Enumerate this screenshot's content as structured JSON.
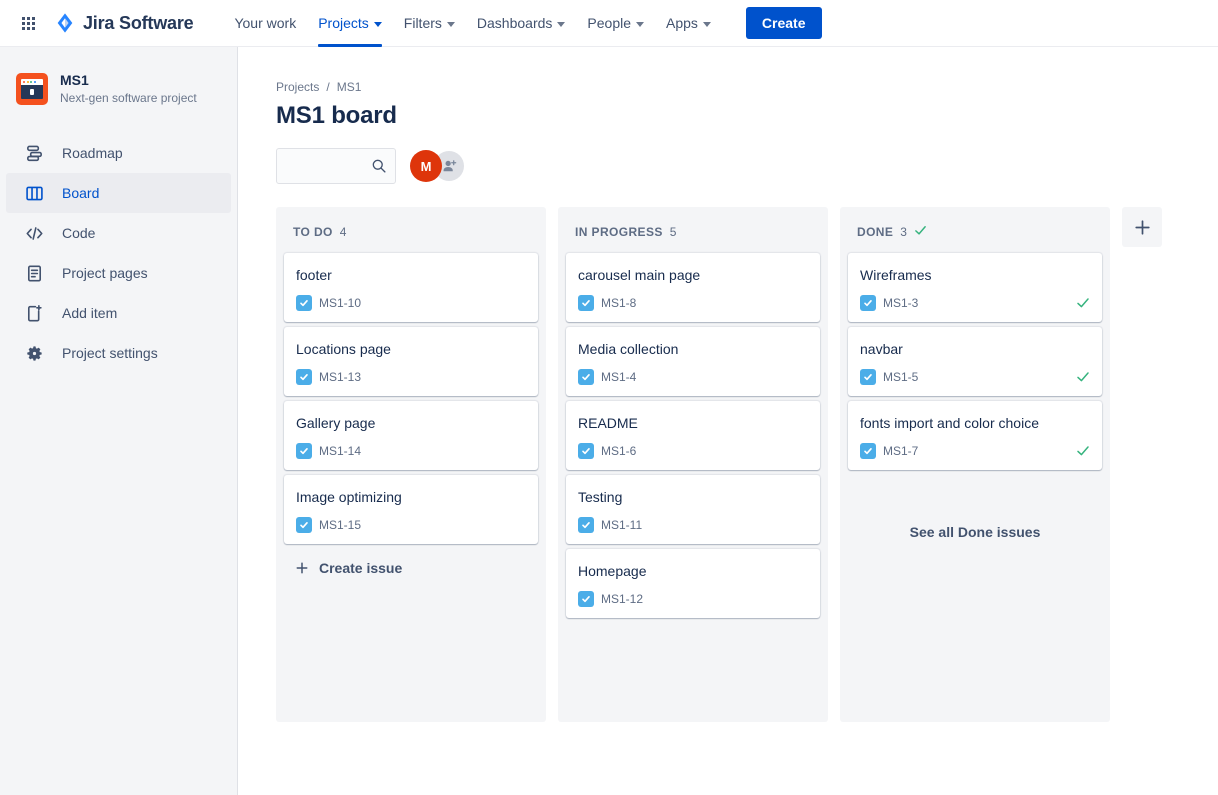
{
  "topnav": {
    "app_switcher_icon": "app-grid-icon",
    "brand": "Jira Software",
    "items": [
      {
        "label": "Your work",
        "has_caret": false,
        "active": false
      },
      {
        "label": "Projects",
        "has_caret": true,
        "active": true
      },
      {
        "label": "Filters",
        "has_caret": true,
        "active": false
      },
      {
        "label": "Dashboards",
        "has_caret": true,
        "active": false
      },
      {
        "label": "People",
        "has_caret": true,
        "active": false
      },
      {
        "label": "Apps",
        "has_caret": true,
        "active": false
      }
    ],
    "create_label": "Create",
    "create_color": "#0052CC"
  },
  "sidebar": {
    "project": {
      "name": "MS1",
      "subtitle": "Next-gen software project",
      "icon": "project-avatar-icon",
      "icon_color": "#F4511E"
    },
    "items": [
      {
        "label": "Roadmap",
        "icon": "roadmap-icon",
        "selected": false
      },
      {
        "label": "Board",
        "icon": "board-icon",
        "selected": true
      },
      {
        "label": "Code",
        "icon": "code-icon",
        "selected": false
      },
      {
        "label": "Project pages",
        "icon": "pages-icon",
        "selected": false
      },
      {
        "label": "Add item",
        "icon": "add-item-icon",
        "selected": false
      },
      {
        "label": "Project settings",
        "icon": "gear-icon",
        "selected": false
      }
    ]
  },
  "main": {
    "breadcrumb": {
      "parent": "Projects",
      "separator": "/",
      "current": "MS1"
    },
    "title": "MS1 board",
    "search": {
      "value": "",
      "placeholder": "",
      "icon": "search-icon"
    },
    "avatars": [
      {
        "initial": "M",
        "color": "#DE350B",
        "name": "user-avatar"
      }
    ],
    "add_people_icon": "add-person-icon",
    "add_column_icon": "plus-icon"
  },
  "board": {
    "columns": [
      {
        "name": "TO DO",
        "count": "4",
        "done_marker": false,
        "cards": [
          {
            "title": "footer",
            "key": "MS1-10",
            "icon": "task-icon",
            "done": false
          },
          {
            "title": "Locations page",
            "key": "MS1-13",
            "icon": "task-icon",
            "done": false
          },
          {
            "title": "Gallery page",
            "key": "MS1-14",
            "icon": "task-icon",
            "done": false
          },
          {
            "title": "Image optimizing",
            "key": "MS1-15",
            "icon": "task-icon",
            "done": false
          }
        ],
        "footer_action": "Create issue",
        "footer_kind": "create"
      },
      {
        "name": "IN PROGRESS",
        "count": "5",
        "done_marker": false,
        "cards": [
          {
            "title": "carousel main page",
            "key": "MS1-8",
            "icon": "task-icon",
            "done": false
          },
          {
            "title": "Media collection",
            "key": "MS1-4",
            "icon": "task-icon",
            "done": false
          },
          {
            "title": "README",
            "key": "MS1-6",
            "icon": "task-icon",
            "done": false
          },
          {
            "title": "Testing",
            "key": "MS1-11",
            "icon": "task-icon",
            "done": false
          },
          {
            "title": "Homepage",
            "key": "MS1-12",
            "icon": "task-icon",
            "done": false
          }
        ],
        "footer_action": "",
        "footer_kind": "none"
      },
      {
        "name": "DONE",
        "count": "3",
        "done_marker": true,
        "cards": [
          {
            "title": "Wireframes",
            "key": "MS1-3",
            "icon": "task-icon",
            "done": true
          },
          {
            "title": "navbar",
            "key": "MS1-5",
            "icon": "task-icon",
            "done": true
          },
          {
            "title": "fonts import and color choice",
            "key": "MS1-7",
            "icon": "task-icon",
            "done": true
          }
        ],
        "footer_action": "See all Done issues",
        "footer_kind": "see-all"
      }
    ]
  },
  "colors": {
    "accent": "#0052CC",
    "task_icon": "#4BADE8",
    "done_check": "#36B37E",
    "column_bg": "#F4F5F7",
    "text": "#172B4D",
    "muted": "#5E6C84"
  }
}
